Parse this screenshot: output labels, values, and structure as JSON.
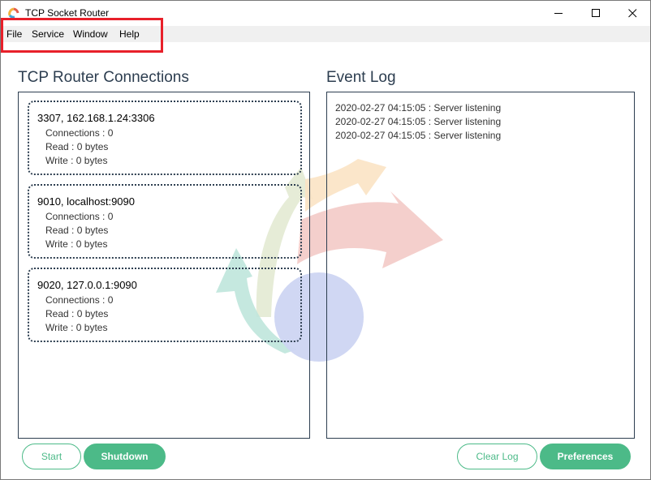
{
  "window": {
    "title": "TCP Socket Router"
  },
  "menu": {
    "items": [
      "File",
      "Service",
      "Window",
      "Help"
    ]
  },
  "connections": {
    "heading": "TCP Router Connections",
    "items": [
      {
        "title": "3307, 162.168.1.24:3306",
        "connections": "Connections : 0",
        "read": "Read : 0 bytes",
        "write": "Write : 0 bytes"
      },
      {
        "title": "9010, localhost:9090",
        "connections": "Connections : 0",
        "read": "Read : 0 bytes",
        "write": "Write : 0 bytes"
      },
      {
        "title": "9020, 127.0.0.1:9090",
        "connections": "Connections : 0",
        "read": "Read : 0 bytes",
        "write": "Write : 0 bytes"
      }
    ]
  },
  "log": {
    "heading": "Event Log",
    "lines": [
      "2020-02-27 04:15:05 : Server listening",
      "2020-02-27 04:15:05 : Server listening",
      "2020-02-27 04:15:05 : Server listening"
    ]
  },
  "buttons": {
    "start": "Start",
    "shutdown": "Shutdown",
    "clear_log": "Clear Log",
    "preferences": "Preferences"
  },
  "colors": {
    "accent": "#4cba88",
    "heading": "#2d3e50",
    "highlight": "#e8202a"
  }
}
